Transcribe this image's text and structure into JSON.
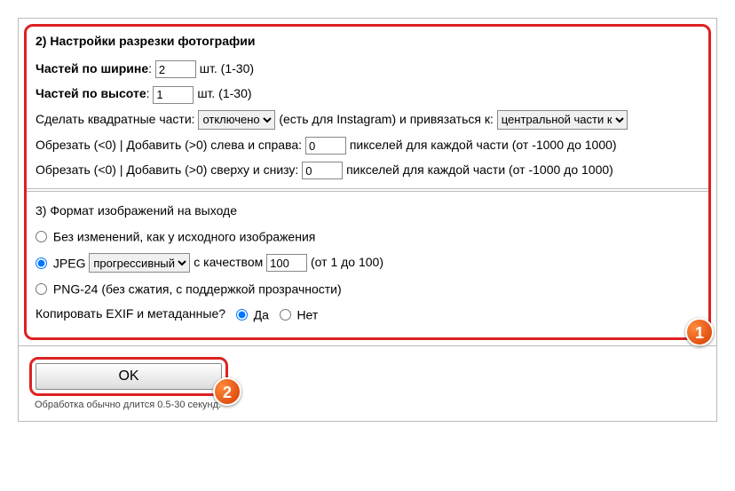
{
  "section2": {
    "title": "2) Настройки разрезки фотографии",
    "width_label": "Частей по ширине",
    "width_value": "2",
    "width_suffix": "шт. (1-30)",
    "height_label": "Частей по высоте",
    "height_value": "1",
    "height_suffix": "шт. (1-30)",
    "square_label": "Сделать квадратные части:",
    "square_selected": "отключено",
    "square_mid": "(есть для Instagram) и привязаться к:",
    "square_anchor_selected": "центральной части к",
    "crop_lr_label": "Обрезать (<0) | Добавить (>0) слева и справа:",
    "crop_lr_value": "0",
    "crop_lr_suffix": "пикселей для каждой части (от -1000 до 1000)",
    "crop_tb_label": "Обрезать (<0) | Добавить (>0) сверху и снизу:",
    "crop_tb_value": "0",
    "crop_tb_suffix": "пикселей для каждой части (от -1000 до 1000)"
  },
  "section3": {
    "title": "3) Формат изображений на выходе",
    "opt_nochange": "Без изменений, как у исходного изображения",
    "opt_jpeg_prefix": "JPEG",
    "jpeg_mode_selected": "прогрессивный",
    "jpeg_quality_label": "с качеством",
    "jpeg_quality_value": "100",
    "jpeg_quality_suffix": "(от 1 до 100)",
    "opt_png": "PNG-24 (без сжатия, с поддержкой прозрачности)",
    "exif_label": "Копировать EXIF и метаданные?",
    "exif_yes": "Да",
    "exif_no": "Нет"
  },
  "bottom": {
    "ok": "OK",
    "hint": "Обработка обычно длится 0.5-30 секунд."
  },
  "badges": {
    "one": "1",
    "two": "2"
  }
}
